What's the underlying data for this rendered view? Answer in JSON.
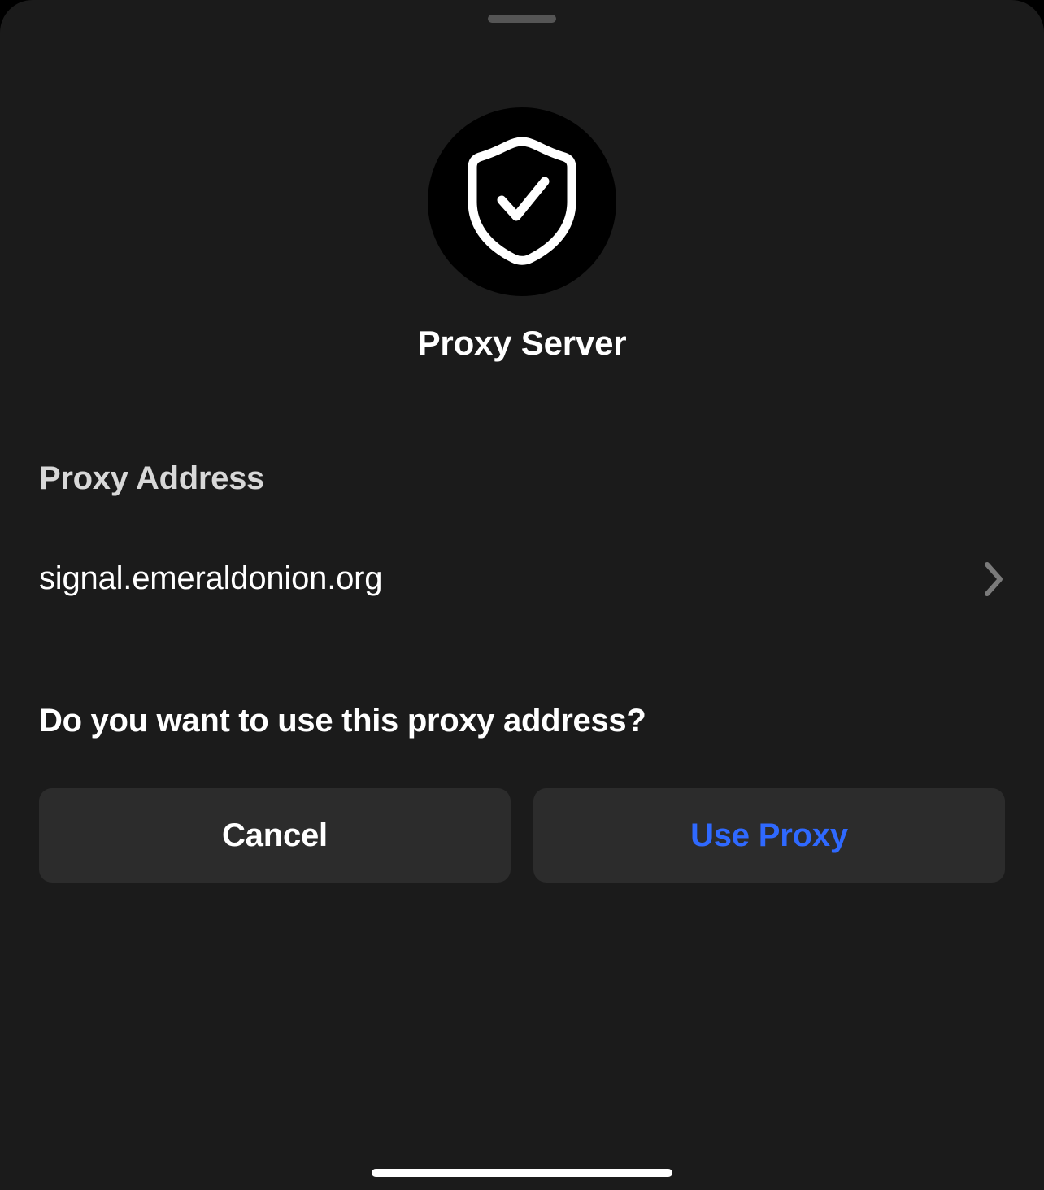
{
  "title": "Proxy Server",
  "section_heading": "Proxy Address",
  "proxy_address": "signal.emeraldonion.org",
  "prompt": "Do you want to use this proxy address?",
  "buttons": {
    "cancel": "Cancel",
    "use_proxy": "Use Proxy"
  }
}
